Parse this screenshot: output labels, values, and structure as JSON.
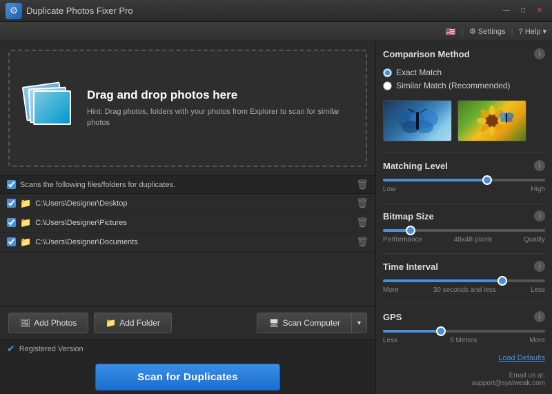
{
  "titleBar": {
    "title": "Duplicate Photos Fixer Pro",
    "controls": {
      "minimize": "—",
      "maximize": "□",
      "close": "✕"
    }
  },
  "toolbar": {
    "flag": "🇺🇸",
    "settings": "Settings",
    "help": "? Help",
    "separator": "|"
  },
  "dropZone": {
    "title": "Drag and drop photos here",
    "hint": "Hint: Drag photos, folders with your photos from Explorer to scan for similar photos"
  },
  "folderList": {
    "header": "Scans the following files/folders for duplicates.",
    "folders": [
      {
        "path": "C:\\Users\\Designer\\Desktop",
        "checked": true
      },
      {
        "path": "C:\\Users\\Designer\\Pictures",
        "checked": true
      },
      {
        "path": "C:\\Users\\Designer\\Documents",
        "checked": true
      }
    ]
  },
  "buttons": {
    "addPhotos": "Add Photos",
    "addFolder": "Add Folder",
    "scanComputer": "Scan Computer",
    "scanForDuplicates": "Scan for Duplicates"
  },
  "status": {
    "text": "Registered Version"
  },
  "rightPanel": {
    "comparisonMethod": {
      "title": "Comparison Method",
      "options": [
        {
          "label": "Exact Match",
          "selected": true
        },
        {
          "label": "Similar Match (Recommended)",
          "selected": false
        }
      ]
    },
    "matchingLevel": {
      "title": "Matching Level",
      "low": "Low",
      "high": "High",
      "value": 65
    },
    "bitmapSize": {
      "title": "Bitmap Size",
      "performance": "Performance",
      "quality": "Quality",
      "center": "48x48 pixels",
      "value": 15
    },
    "timeInterval": {
      "title": "Time Interval",
      "more": "More",
      "less": "Less",
      "center": "30 seconds and less",
      "value": 75
    },
    "gps": {
      "title": "GPS",
      "less": "Less",
      "more": "More",
      "center": "5 Meters",
      "value": 35
    },
    "loadDefaults": "Load Defaults",
    "email": {
      "line1": "Email us at:",
      "line2": "support@systweak.com"
    }
  }
}
